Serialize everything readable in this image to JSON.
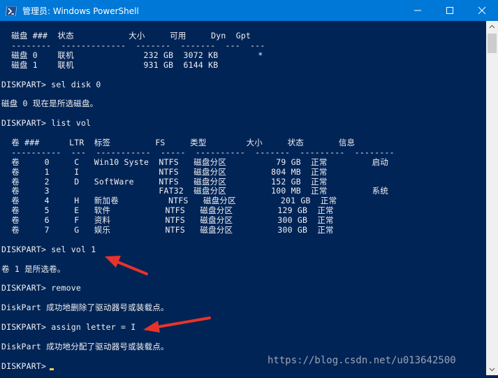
{
  "window": {
    "title": "管理员: Windows PowerShell",
    "icon": "powershell-icon",
    "controls": [
      "minimize-icon",
      "maximize-icon",
      "close-icon"
    ]
  },
  "console": {
    "lines": [
      "  磁盘 ###  状态           大小     可用     Dyn  Gpt",
      "  --------  -------------  -------  -------  ---  ---",
      "  磁盘 0    联机              232 GB  3072 KB        *",
      "  磁盘 1    联机              931 GB  6144 KB",
      "",
      "DISKPART> sel disk 0",
      "",
      "磁盘 0 现在是所选磁盘。",
      "",
      "DISKPART> list vol",
      "",
      "  卷 ###      LTR  标签         FS     类型        大小     状态       信息",
      "  ----------  ---  -----------  -----  ----------  -------  ---------  --------",
      "  卷     0     C   Win10 Syste  NTFS   磁盘分区          79 GB  正常         启动",
      "  卷     1     I                NTFS   磁盘分区         804 MB  正常",
      "  卷     2     D   SoftWare     NTFS   磁盘分区         152 GB  正常",
      "  卷     3                      FAT32  磁盘分区         100 MB  正常         系统",
      "  卷     4     H   新加卷          NTFS   磁盘分区         201 GB  正常",
      "  卷     5     E   软件           NTFS   磁盘分区         129 GB  正常",
      "  卷     6     F   资料           NTFS   磁盘分区         300 GB  正常",
      "  卷     7     G   娱乐           NTFS   磁盘分区         300 GB  正常",
      "",
      "DISKPART> sel vol 1",
      "",
      "卷 1 是所选卷。",
      "",
      "DISKPART> remove",
      "",
      "DiskPart 成功地删除了驱动器号或装载点。",
      "",
      "DISKPART> assign letter = I",
      "",
      "DiskPart 成功地分配了驱动器号或装载点。",
      "",
      "DISKPART> "
    ],
    "cursor_color": "#f0d060"
  },
  "watermark": "https://blog.csdn.net/u013642500",
  "colors": {
    "background": "#012456",
    "titlebar": "#0078d7",
    "text": "#f0f0f0",
    "annotation_arrow": "#e8332a"
  }
}
